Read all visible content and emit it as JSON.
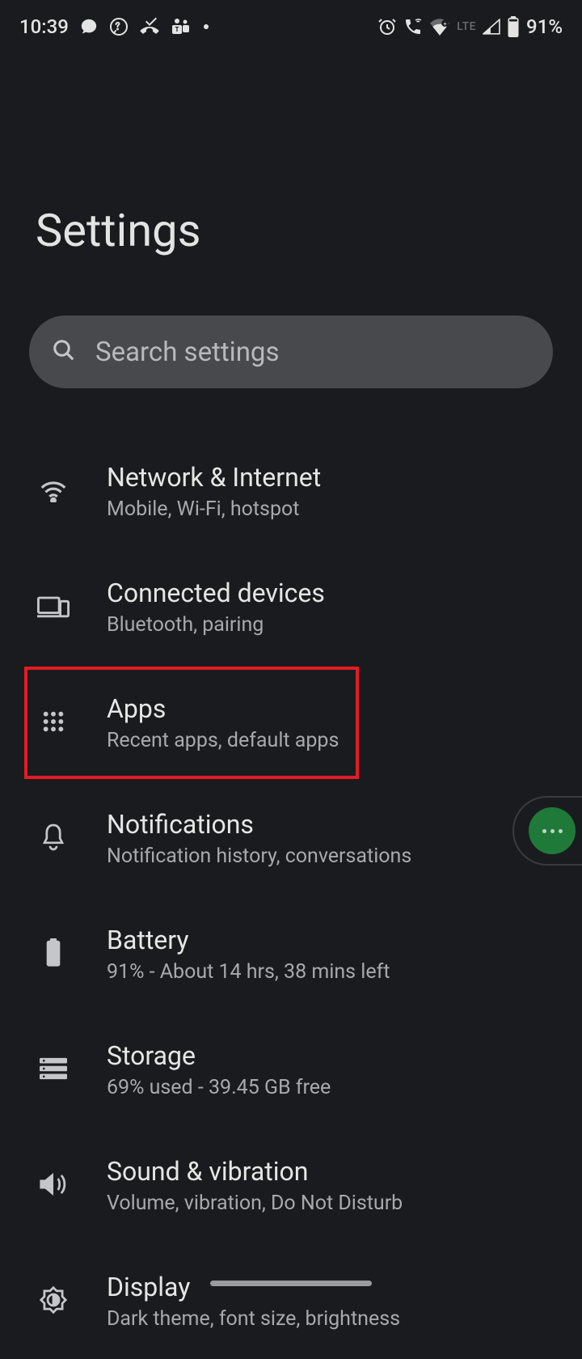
{
  "status_bar": {
    "time": "10:39",
    "battery_text": "91%"
  },
  "page": {
    "title": "Settings"
  },
  "search": {
    "placeholder": "Search settings"
  },
  "items": [
    {
      "title": "Network & Internet",
      "subtitle": "Mobile, Wi-Fi, hotspot"
    },
    {
      "title": "Connected devices",
      "subtitle": "Bluetooth, pairing"
    },
    {
      "title": "Apps",
      "subtitle": "Recent apps, default apps"
    },
    {
      "title": "Notifications",
      "subtitle": "Notification history, conversations"
    },
    {
      "title": "Battery",
      "subtitle": "91% - About 14 hrs, 38 mins left"
    },
    {
      "title": "Storage",
      "subtitle": "69% used - 39.45 GB free"
    },
    {
      "title": "Sound & vibration",
      "subtitle": "Volume, vibration, Do Not Disturb"
    },
    {
      "title": "Display",
      "subtitle": "Dark theme, font size, brightness"
    }
  ],
  "highlighted_index": 2
}
